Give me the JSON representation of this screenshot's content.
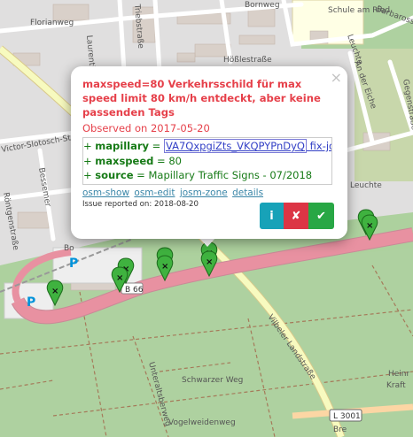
{
  "map": {
    "streets": [
      "Florianweg",
      "Laurentiusstr",
      "Triebstraße",
      "Hößlestraße",
      "Bornweg",
      "Schule am Ried",
      "Barbarossa",
      "Leuchte",
      "An der Eiche",
      "Leuchte",
      "Gegenstraße",
      "Victor-Slotosch-Straße",
      "Bessemer",
      "Röntgenstraße",
      "Bo",
      "Vilbeler Landstraße",
      "Unteraltsberweg",
      "Schwarzer Weg",
      "Vogelweidenweg",
      "L 3001",
      "Heinr",
      "Kraft",
      "Bre",
      "B 66"
    ],
    "parking": [
      "P",
      "P"
    ],
    "marker_count": 9
  },
  "popup": {
    "close": "×",
    "title": "maxspeed=80 Verkehrsschild für max speed limit 80 km/h entdeckt, aber keine passenden Tags",
    "observed": "Observed on 2017-05-20",
    "tags": [
      {
        "prefix": "+ ",
        "key": "mapillary",
        "eq": " = ",
        "value": "VA7QxpgiZts_VKQPYPnDyQ",
        "extra": " fix-josm"
      },
      {
        "prefix": "+ ",
        "key": "maxspeed",
        "eq": " = ",
        "value": "80",
        "extra": ""
      },
      {
        "prefix": "+ ",
        "key": "source",
        "eq": " = ",
        "value": "Mapillary Traffic Signs - 07/2018",
        "extra": ""
      }
    ],
    "links": [
      "osm-show",
      "osm-edit",
      "josm-zone",
      "details"
    ],
    "reported": "Issue reported on: 2018-08-20",
    "buttons": {
      "info": "i",
      "false_positive": "✘",
      "fixed": "✔"
    }
  },
  "colors": {
    "accent_red": "#e6404a",
    "tag_green": "#167a16",
    "info": "#17a2b8",
    "danger": "#dc3545",
    "success": "#28a745",
    "marker": "#3fb23f"
  }
}
